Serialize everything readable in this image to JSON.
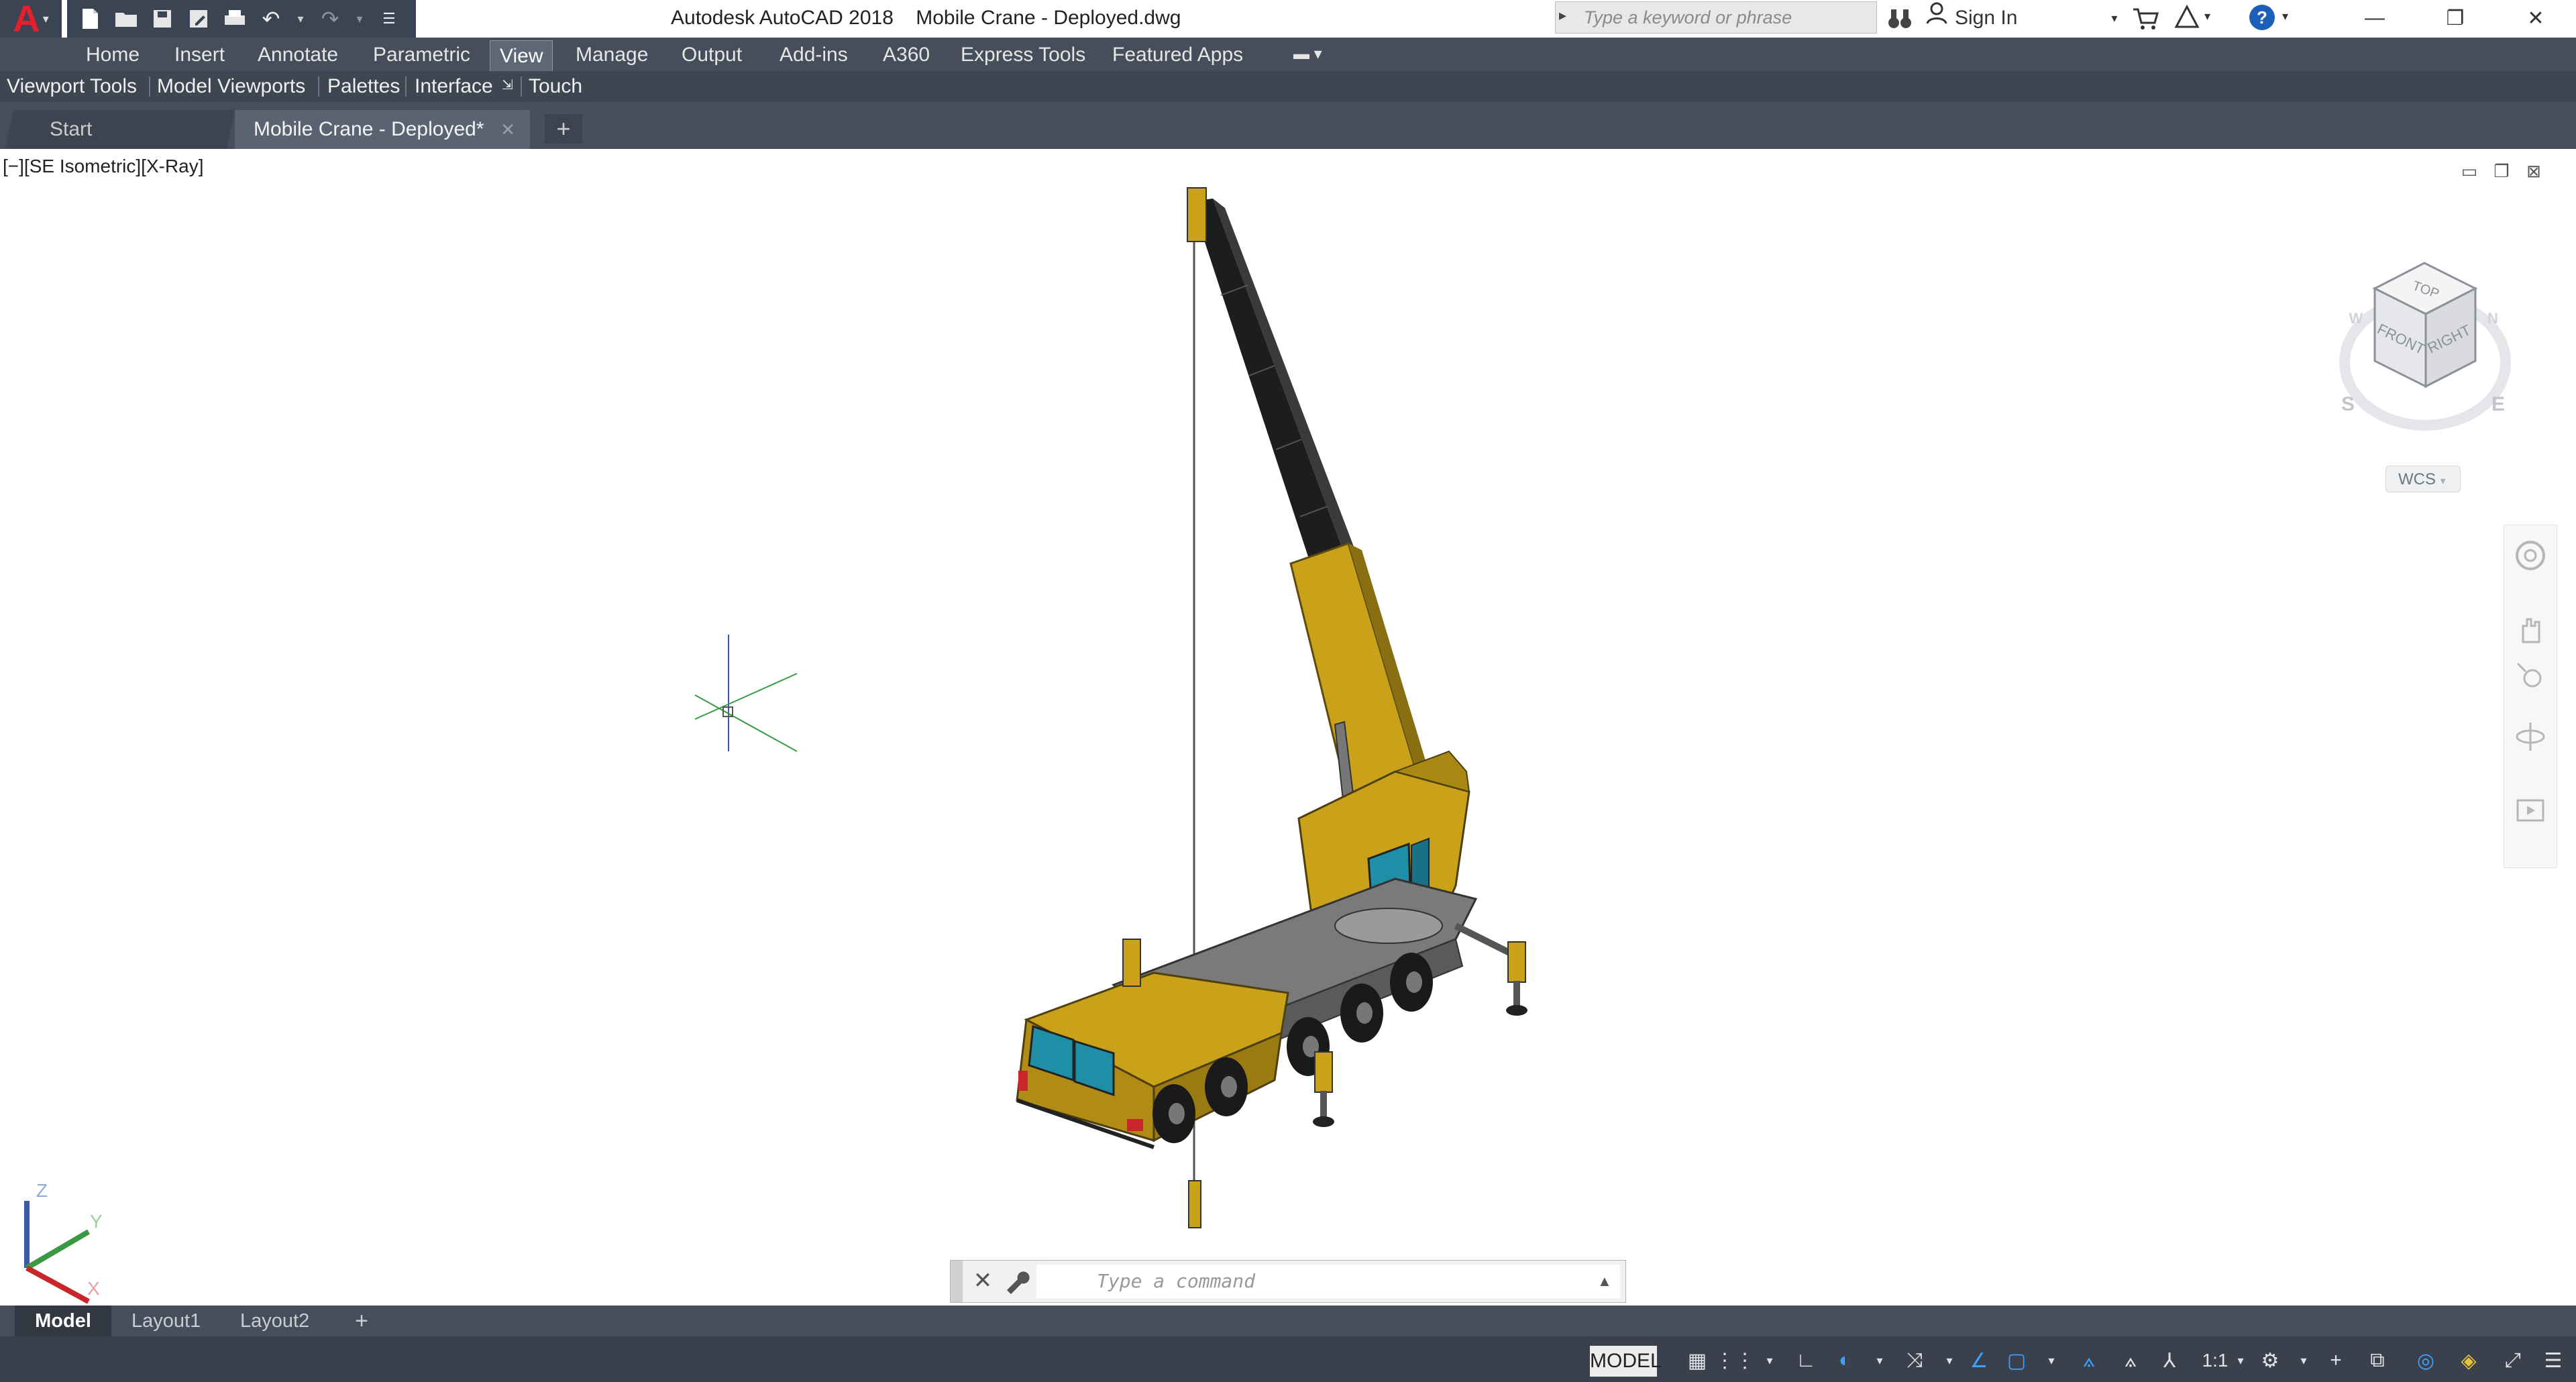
{
  "title": {
    "app": "Autodesk AutoCAD 2018",
    "file": "Mobile Crane - Deployed.dwg",
    "search_placeholder": "Type a keyword or phrase",
    "sign_in": "Sign In"
  },
  "ribbon_tabs": [
    "Home",
    "Insert",
    "Annotate",
    "Parametric",
    "View",
    "Manage",
    "Output",
    "Add-ins",
    "A360",
    "Express Tools",
    "Featured Apps"
  ],
  "active_ribbon_tab": "View",
  "panels": [
    "Viewport Tools",
    "Model Viewports",
    "Palettes",
    "Interface",
    "Touch"
  ],
  "doc_tabs": {
    "start": "Start",
    "current": "Mobile Crane - Deployed*",
    "add": "+"
  },
  "viewport": {
    "label": "[−][SE Isometric][X-Ray]",
    "wcs": "WCS",
    "viewcube": {
      "top": "TOP",
      "front": "FRONT",
      "right": "RIGHT",
      "compass": [
        "S",
        "E",
        "W",
        "N"
      ]
    },
    "ucs_axes": {
      "x": "X",
      "y": "Y",
      "z": "Z"
    }
  },
  "command_line": {
    "placeholder": "Type a command"
  },
  "layout_tabs": [
    "Model",
    "Layout1",
    "Layout2"
  ],
  "layout_add": "+",
  "statusbar": {
    "model": "MODEL",
    "scale": "1:1"
  },
  "colors": {
    "crane_yellow": "#c9a21a",
    "boom_black": "#1d1d1d",
    "window_blue": "#1f8fa8",
    "chassis_gray": "#7a7a7a",
    "accent_blue": "#3ea0ff"
  }
}
